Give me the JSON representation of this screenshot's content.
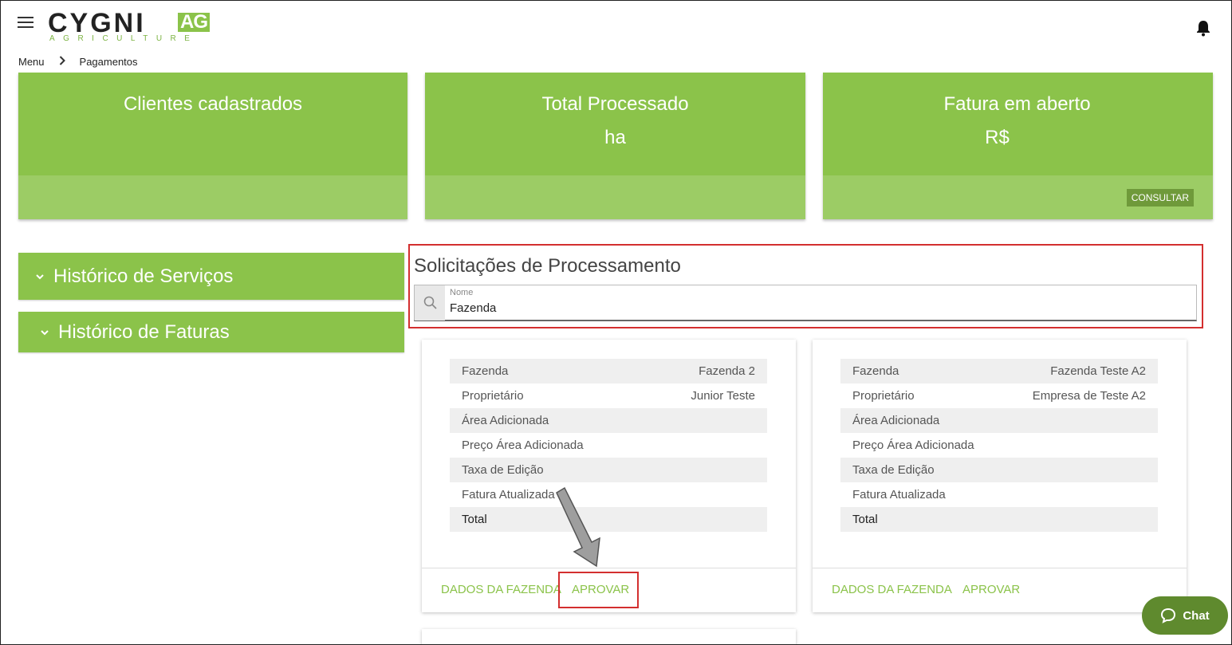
{
  "header": {
    "logo_main": "CYGNI",
    "logo_ag": "AG",
    "logo_sub": "AGRICULTURE"
  },
  "breadcrumb": {
    "items": [
      "Menu",
      "Pagamentos"
    ]
  },
  "stats": [
    {
      "title": "Clientes cadastrados",
      "value": ""
    },
    {
      "title": "Total Processado",
      "value": "ha"
    },
    {
      "title": "Fatura em aberto",
      "value": "R$",
      "button": "CONSULTAR"
    }
  ],
  "accordions": {
    "servicos": "Histórico de Serviços",
    "faturas": "Histórico de Faturas"
  },
  "solicitacoes": {
    "title": "Solicitações de Processamento",
    "search_label": "Nome",
    "search_value": "Fazenda"
  },
  "cards": [
    {
      "rows": [
        {
          "label": "Fazenda",
          "value": "Fazenda 2"
        },
        {
          "label": "Proprietário",
          "value": "Junior Teste"
        },
        {
          "label": "Área Adicionada",
          "value": ""
        },
        {
          "label": "Preço Área Adicionada",
          "value": ""
        },
        {
          "label": "Taxa de Edição",
          "value": ""
        },
        {
          "label": "Fatura Atualizada",
          "value": ""
        },
        {
          "label": "Total",
          "value": ""
        }
      ],
      "btn_dados": "DADOS DA FAZENDA",
      "btn_aprovar": "APROVAR"
    },
    {
      "rows": [
        {
          "label": "Fazenda",
          "value": "Fazenda Teste A2"
        },
        {
          "label": "Proprietário",
          "value": "Empresa de Teste A2"
        },
        {
          "label": "Área Adicionada",
          "value": ""
        },
        {
          "label": "Preço Área Adicionada",
          "value": ""
        },
        {
          "label": "Taxa de Edição",
          "value": ""
        },
        {
          "label": "Fatura Atualizada",
          "value": ""
        },
        {
          "label": "Total",
          "value": ""
        }
      ],
      "btn_dados": "DADOS DA FAZENDA",
      "btn_aprovar": "APROVAR"
    }
  ],
  "chat": {
    "label": "Chat"
  },
  "colors": {
    "brand_green": "#8bc34a",
    "brand_green_light": "#9ccc65",
    "highlight_red": "#d32f2f",
    "chat_green": "#5f8a2e"
  }
}
